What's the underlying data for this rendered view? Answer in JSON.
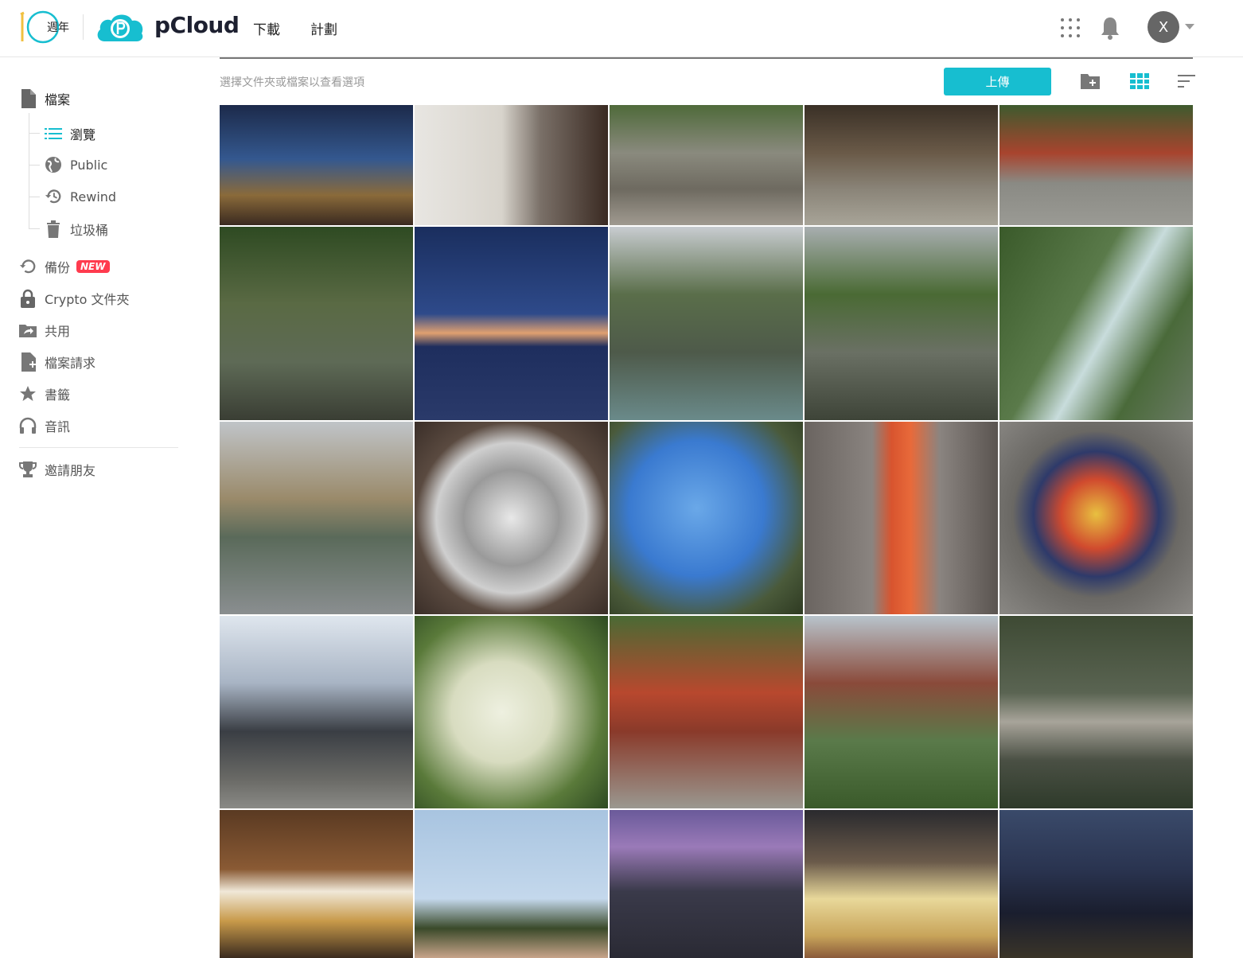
{
  "header": {
    "anniversary_label": "週年",
    "brand": "pCloud",
    "nav": {
      "download": "下載",
      "plans": "計劃"
    },
    "avatar_initial": "X"
  },
  "sidebar": {
    "files": "檔案",
    "browse": "瀏覽",
    "public": "Public",
    "rewind": "Rewind",
    "trash": "垃圾桶",
    "backup": "備份",
    "new_badge": "NEW",
    "crypto": "Crypto 文件夾",
    "shared": "共用",
    "file_requests": "檔案請求",
    "bookmarks": "書籤",
    "audio": "音訊",
    "invite": "邀請朋友"
  },
  "toolbar": {
    "hint": "選擇文件夾或檔案以查看選項",
    "upload_label": "上傳"
  },
  "colors": {
    "accent": "#17bed0",
    "badge": "#ff3b4e"
  },
  "photos": [
    "tree-light-mall",
    "stone-marker-sign",
    "shrine-stairs",
    "temple-gate-lanterns",
    "red-shrine-courtyard",
    "torii-forest",
    "airplane-wing-dusk",
    "river-gorge",
    "arched-bridge-pond",
    "waterfall",
    "laurel-wreath-sculpture",
    "glass-dome-ceiling",
    "blue-hydrangea",
    "red-post-box",
    "manhole-cover",
    "castle-cloudy-sky",
    "white-hydrangea",
    "red-shrine-hall",
    "ropeway-cable-car",
    "stepping-stones-koi",
    "ice-cream-cone",
    "leaf-against-sky",
    "airplane-cabin",
    "drinks-toast",
    "night-city-wing"
  ]
}
